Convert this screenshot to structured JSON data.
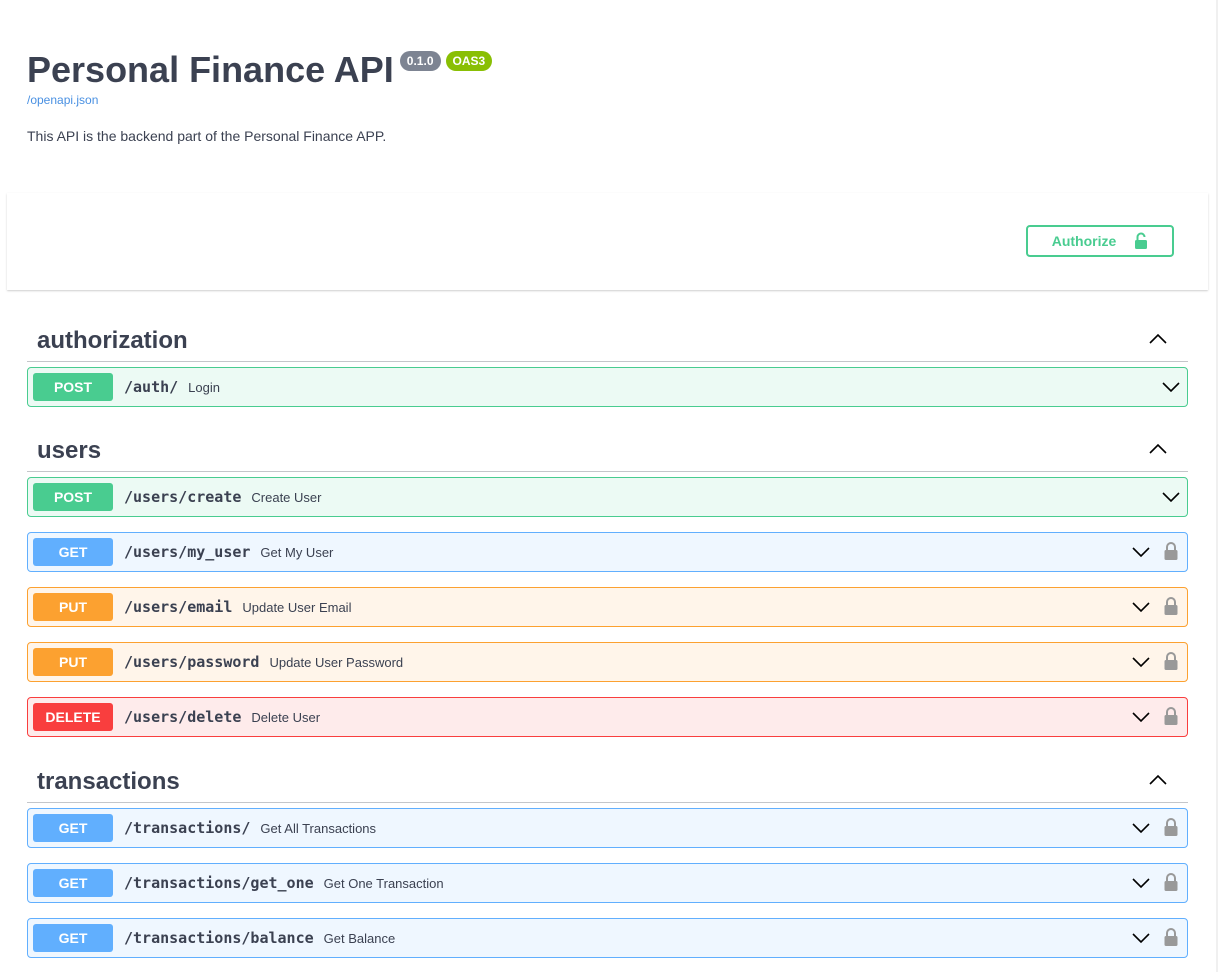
{
  "info": {
    "title": "Personal Finance API",
    "version": "0.1.0",
    "oas": "OAS3",
    "spec_url": "/openapi.json",
    "description": "This API is the backend part of the Personal Finance APP."
  },
  "authorize": {
    "label": "Authorize",
    "icon": "unlocked-lock-icon"
  },
  "tags": [
    {
      "name": "authorization",
      "operations": [
        {
          "method": "POST",
          "path": "/auth/",
          "summary": "Login",
          "locked": false
        }
      ]
    },
    {
      "name": "users",
      "operations": [
        {
          "method": "POST",
          "path": "/users/create",
          "summary": "Create User",
          "locked": false
        },
        {
          "method": "GET",
          "path": "/users/my_user",
          "summary": "Get My User",
          "locked": true
        },
        {
          "method": "PUT",
          "path": "/users/email",
          "summary": "Update User Email",
          "locked": true
        },
        {
          "method": "PUT",
          "path": "/users/password",
          "summary": "Update User Password",
          "locked": true
        },
        {
          "method": "DELETE",
          "path": "/users/delete",
          "summary": "Delete User",
          "locked": true
        }
      ]
    },
    {
      "name": "transactions",
      "operations": [
        {
          "method": "GET",
          "path": "/transactions/",
          "summary": "Get All Transactions",
          "locked": true
        },
        {
          "method": "GET",
          "path": "/transactions/get_one",
          "summary": "Get One Transaction",
          "locked": true
        },
        {
          "method": "GET",
          "path": "/transactions/balance",
          "summary": "Get Balance",
          "locked": true
        }
      ]
    }
  ],
  "colors": {
    "post": "#49cc90",
    "get": "#61afe",
    "put": "#fca130",
    "delete": "#f93e3e",
    "text": "#3b4151",
    "link": "#4990e2"
  }
}
